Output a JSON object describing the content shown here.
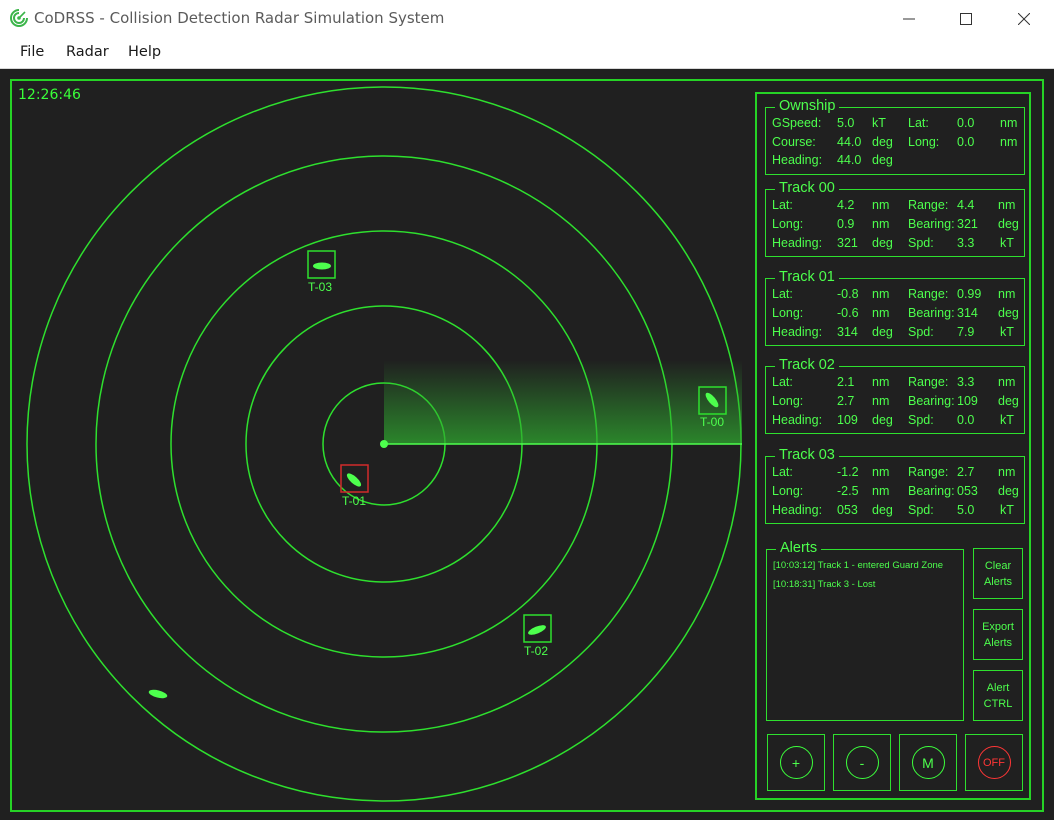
{
  "window": {
    "title": "CoDRSS - Collision Detection Radar Simulation System"
  },
  "menu": {
    "file": "File",
    "radar": "Radar",
    "help": "Help"
  },
  "clock": "12:26:46",
  "colors": {
    "accent": "#26d326",
    "text": "#4dff4d",
    "alert_red": "#ff3636",
    "background": "#202020"
  },
  "radar": {
    "ring_count": 5,
    "sweep_angle_deg": 0,
    "targets": [
      {
        "label": "T-03",
        "boxed": true,
        "alert": false
      },
      {
        "label": "T-00",
        "boxed": true,
        "alert": false
      },
      {
        "label": "T-01",
        "boxed": true,
        "alert": true
      },
      {
        "label": "T-02",
        "boxed": true,
        "alert": false
      },
      {
        "label": "",
        "boxed": false,
        "alert": false
      }
    ]
  },
  "ownship": {
    "title": "Ownship",
    "rows": [
      {
        "k1": "GSpeed:",
        "v1": "5.0",
        "u1": "kT",
        "k2": "Lat:",
        "v2": "0.0",
        "u2": "nm"
      },
      {
        "k1": "Course:",
        "v1": "44.0",
        "u1": "deg",
        "k2": "Long:",
        "v2": "0.0",
        "u2": "nm"
      },
      {
        "k1": "Heading:",
        "v1": "44.0",
        "u1": "deg",
        "k2": "",
        "v2": "",
        "u2": ""
      }
    ]
  },
  "tracks": [
    {
      "title": "Track 00",
      "rows": [
        {
          "k1": "Lat:",
          "v1": "4.2",
          "u1": "nm",
          "k2": "Range:",
          "v2": "4.4",
          "u2": "nm"
        },
        {
          "k1": "Long:",
          "v1": "0.9",
          "u1": "nm",
          "k2": "Bearing:",
          "v2": "321",
          "u2": "deg"
        },
        {
          "k1": "Heading:",
          "v1": "321",
          "u1": "deg",
          "k2": "Spd:",
          "v2": "3.3",
          "u2": "kT"
        }
      ]
    },
    {
      "title": "Track 01",
      "rows": [
        {
          "k1": "Lat:",
          "v1": "-0.8",
          "u1": "nm",
          "k2": "Range:",
          "v2": "0.99",
          "u2": "nm"
        },
        {
          "k1": "Long:",
          "v1": "-0.6",
          "u1": "nm",
          "k2": "Bearing:",
          "v2": "314",
          "u2": "deg"
        },
        {
          "k1": "Heading:",
          "v1": "314",
          "u1": "deg",
          "k2": "Spd:",
          "v2": "7.9",
          "u2": "kT"
        }
      ]
    },
    {
      "title": "Track 02",
      "rows": [
        {
          "k1": "Lat:",
          "v1": "2.1",
          "u1": "nm",
          "k2": "Range:",
          "v2": "3.3",
          "u2": "nm"
        },
        {
          "k1": "Long:",
          "v1": "2.7",
          "u1": "nm",
          "k2": "Bearing:",
          "v2": "109",
          "u2": "deg"
        },
        {
          "k1": "Heading:",
          "v1": "109",
          "u1": "deg",
          "k2": "Spd:",
          "v2": "0.0",
          "u2": "kT"
        }
      ]
    },
    {
      "title": "Track 03",
      "rows": [
        {
          "k1": "Lat:",
          "v1": "-1.2",
          "u1": "nm",
          "k2": "Range:",
          "v2": "2.7",
          "u2": "nm"
        },
        {
          "k1": "Long:",
          "v1": "-2.5",
          "u1": "nm",
          "k2": "Bearing:",
          "v2": "053",
          "u2": "deg"
        },
        {
          "k1": "Heading:",
          "v1": "053",
          "u1": "deg",
          "k2": "Spd:",
          "v2": "5.0",
          "u2": "kT"
        }
      ]
    }
  ],
  "alerts": {
    "title": "Alerts",
    "items": [
      "[10:03:12] Track 1 - entered Guard Zone",
      "[10:18:31] Track 3 - Lost"
    ],
    "clear_label": "Clear\nAlerts",
    "export_label": "Export\nAlerts",
    "ctrl_label": "Alert\nCTRL"
  },
  "controls": {
    "zoom_in": "+",
    "zoom_out": "-",
    "mode": "M",
    "power": "OFF"
  }
}
